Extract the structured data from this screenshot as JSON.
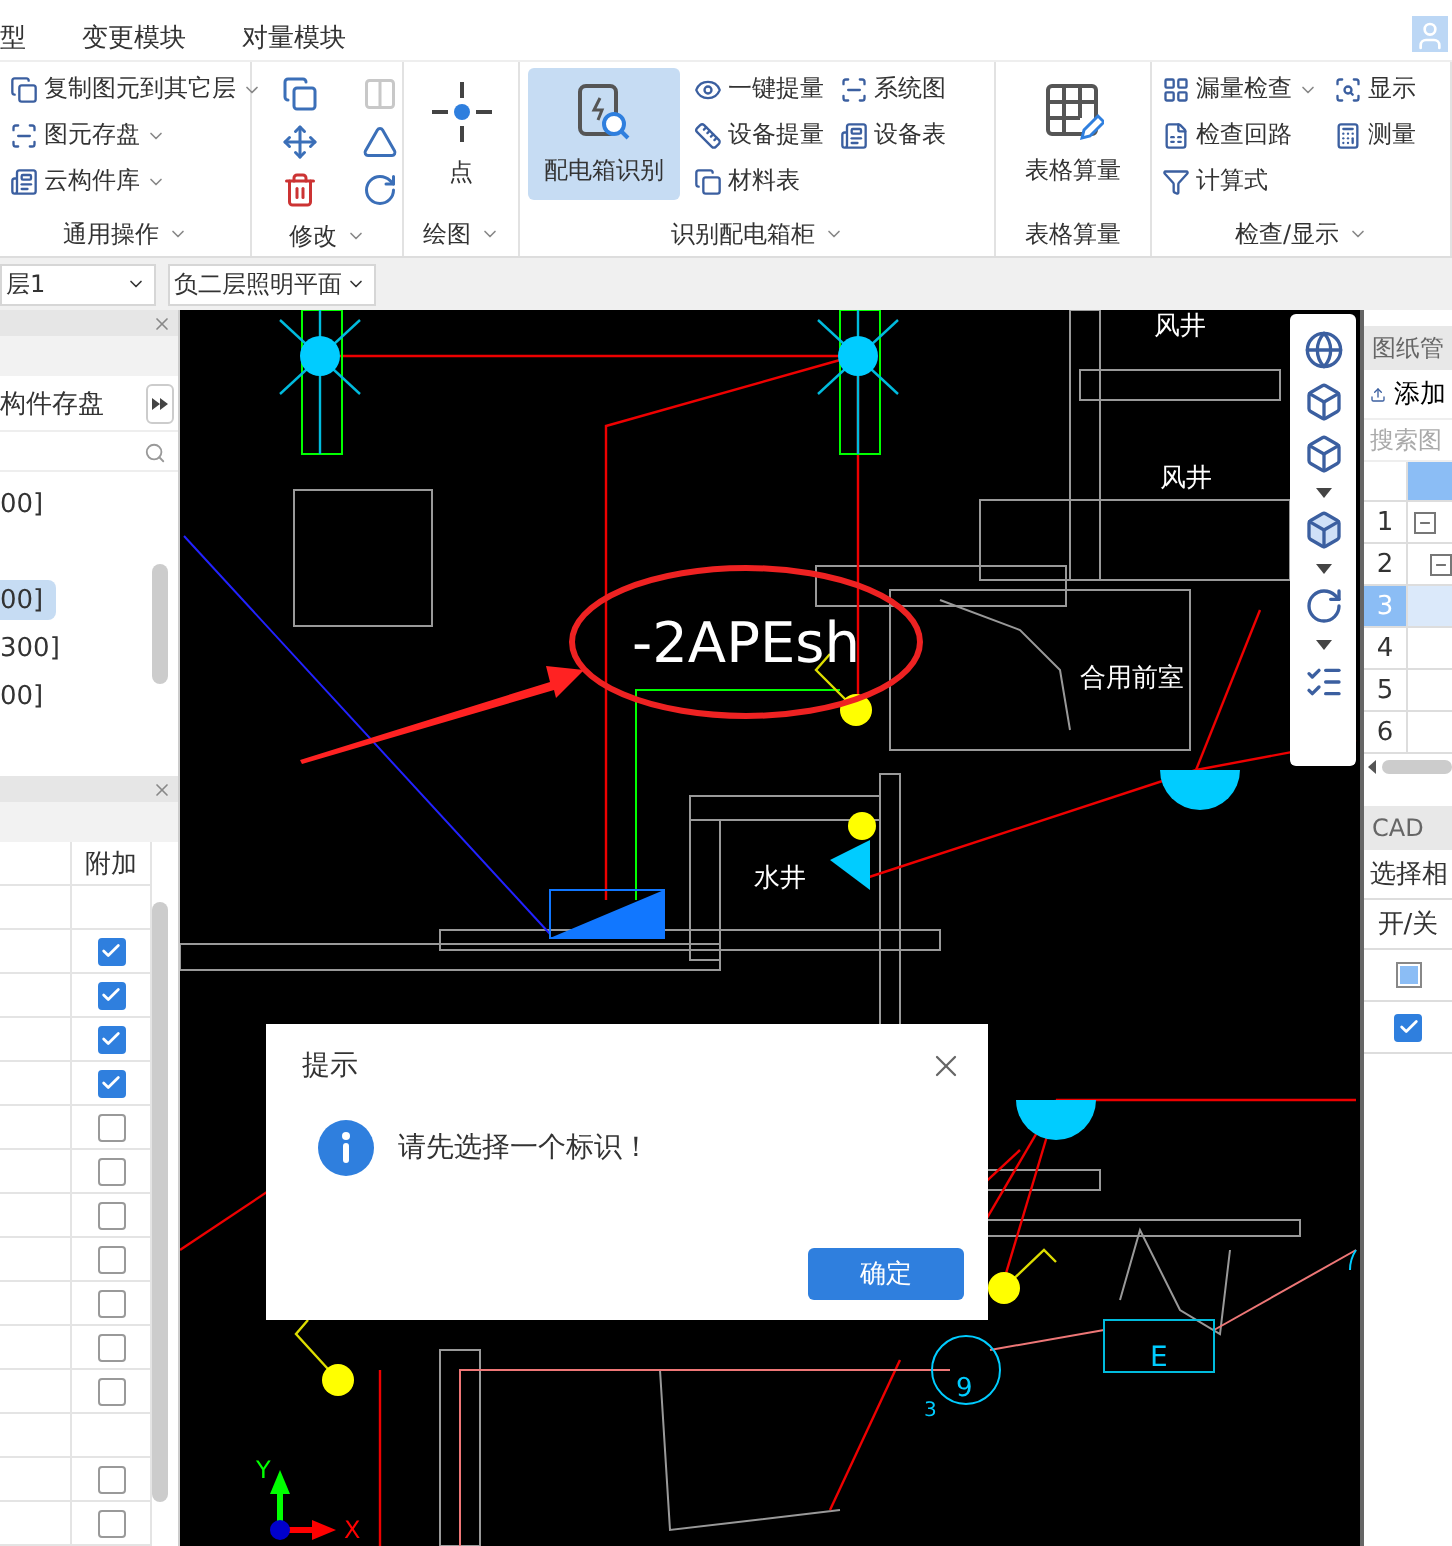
{
  "menu": [
    {
      "label": "型",
      "selected": false
    },
    {
      "label": "变更模块",
      "selected": false
    },
    {
      "label": "对量模块",
      "selected": false
    }
  ],
  "ribbon": [
    {
      "title": "通用操作",
      "dropdown": true,
      "items": [
        {
          "kind": "small",
          "label": "复制图元到其它层",
          "dropdown": true
        },
        {
          "kind": "small",
          "label": "图元存盘",
          "dropdown": true
        },
        {
          "kind": "small",
          "label": "云构件库",
          "dropdown": true
        }
      ]
    },
    {
      "title": "修改",
      "dropdown": true,
      "items": [
        {
          "kind": "icon",
          "disabled": false
        },
        {
          "kind": "icon",
          "disabled": true
        },
        {
          "kind": "icon",
          "disabled": false
        },
        {
          "kind": "icon",
          "disabled": false
        },
        {
          "kind": "icon",
          "disabled": false
        },
        {
          "kind": "icon",
          "disabled": false
        }
      ]
    },
    {
      "title": "绘图",
      "dropdown": true,
      "items": [
        {
          "kind": "big",
          "label": "点",
          "selected": false
        }
      ]
    },
    {
      "title": "识别配电箱柜",
      "dropdown": true,
      "items": [
        {
          "kind": "big",
          "label": "配电箱识别",
          "selected": true
        },
        {
          "kind": "small",
          "label": "一键提量",
          "dropdown": false
        },
        {
          "kind": "small",
          "label": "设备提量",
          "dropdown": false
        },
        {
          "kind": "small",
          "label": "材料表",
          "dropdown": false
        },
        {
          "kind": "small",
          "label": "系统图",
          "dropdown": false
        },
        {
          "kind": "small",
          "label": "设备表",
          "dropdown": false
        }
      ]
    },
    {
      "title": "表格算量",
      "dropdown": false,
      "items": [
        {
          "kind": "big",
          "label": "表格算量",
          "selected": false
        }
      ]
    },
    {
      "title": "检查/显示",
      "dropdown": true,
      "items": [
        {
          "kind": "small",
          "label": "漏量检查",
          "dropdown": true
        },
        {
          "kind": "small",
          "label": "检查回路",
          "dropdown": false
        },
        {
          "kind": "small",
          "label": "计算式",
          "dropdown": false
        },
        {
          "kind": "small",
          "label": "显示",
          "dropdown": false
        },
        {
          "kind": "small",
          "label": "测量",
          "dropdown": false
        }
      ]
    }
  ],
  "toolbar": {
    "floor": "层1",
    "drawing": "负二层照明平面"
  },
  "left_panel": {
    "save_label": "构件存盘",
    "list": [
      {
        "label": "00]",
        "selected": false
      },
      {
        "label": "00]",
        "selected": true
      },
      {
        "label": "300]",
        "selected": false
      },
      {
        "label": "00]",
        "selected": false
      }
    ],
    "table": {
      "header": "附加",
      "rows": [
        {
          "kind": "blank"
        },
        {
          "kind": "check",
          "checked": true
        },
        {
          "kind": "check",
          "checked": true
        },
        {
          "kind": "check",
          "checked": true
        },
        {
          "kind": "check",
          "checked": true
        },
        {
          "kind": "check",
          "checked": false
        },
        {
          "kind": "check",
          "checked": false
        },
        {
          "kind": "check",
          "checked": false
        },
        {
          "kind": "check",
          "checked": false
        },
        {
          "kind": "check",
          "checked": false
        },
        {
          "kind": "check",
          "checked": false
        },
        {
          "kind": "check",
          "checked": false
        },
        {
          "kind": "blank"
        },
        {
          "kind": "check",
          "checked": false
        },
        {
          "kind": "check",
          "checked": false
        }
      ]
    }
  },
  "cad": {
    "labels": [
      "-2APEsh",
      "风井",
      "风井",
      "合用前室",
      "水井",
      "9",
      "3",
      "E",
      "X",
      "Y"
    ]
  },
  "dialog": {
    "title": "提示",
    "message": "请先选择一个标识！",
    "button": "确定"
  },
  "right_panel": {
    "drawings_title": "图纸管",
    "add_button": "添加",
    "search": {
      "placeholder": "搜索图"
    },
    "rows": [
      {
        "number": "1",
        "kind": "group",
        "selected": false
      },
      {
        "number": "2",
        "kind": "group",
        "selected": false
      },
      {
        "number": "3",
        "kind": "plain",
        "selected": true
      },
      {
        "number": "4",
        "kind": "plain",
        "selected": false
      },
      {
        "number": "5",
        "kind": "plain",
        "selected": false
      },
      {
        "number": "6",
        "kind": "plain",
        "selected": false
      }
    ],
    "cad_title": "CAD",
    "select_label": "选择相",
    "toggle_header": "开/关",
    "layers": [
      {
        "kind": "partial"
      },
      {
        "kind": "checked"
      }
    ]
  }
}
